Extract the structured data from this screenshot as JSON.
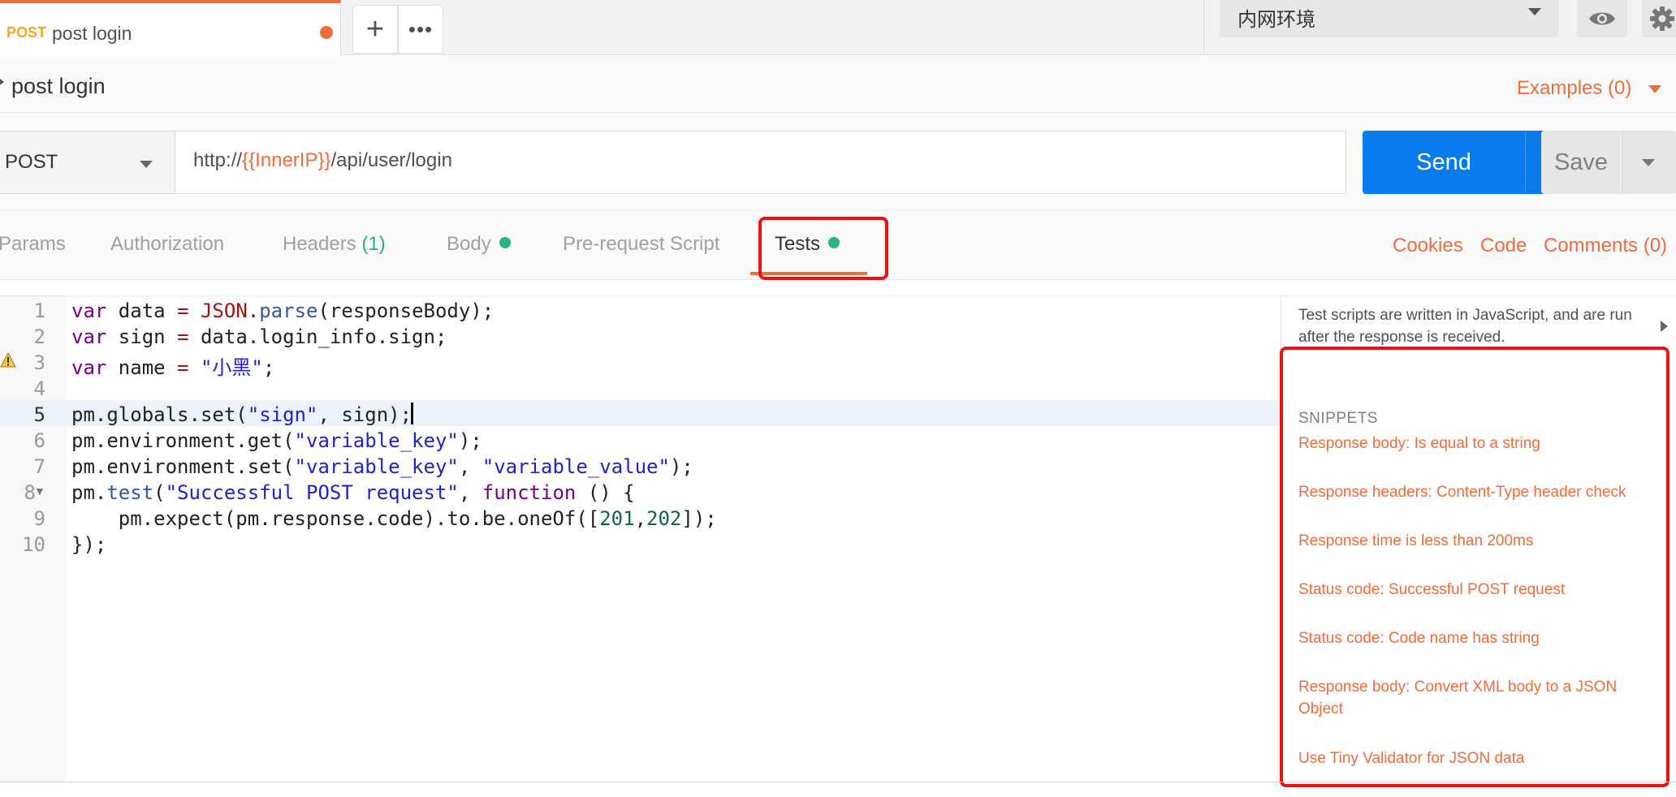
{
  "tabs": {
    "active": {
      "method": "POST",
      "name": "post login",
      "unsaved": true
    },
    "new_tab_symbol": "+",
    "more_tabs_symbol": "•••"
  },
  "environment": {
    "selected": "内网环境",
    "eye_icon": "eye-icon",
    "settings_icon": "gear-icon"
  },
  "request": {
    "title": "post login",
    "examples_label": "Examples (0)",
    "method": "POST",
    "url": {
      "prefix": "http://",
      "variable": "{{InnerIP}}",
      "suffix": "/api/user/login"
    },
    "send_label": "Send",
    "save_label": "Save"
  },
  "subtabs": {
    "params": "Params",
    "authorization": "Authorization",
    "headers": "Headers",
    "headers_count": "(1)",
    "body": "Body",
    "prerequest": "Pre-request Script",
    "tests": "Tests",
    "cookies": "Cookies",
    "code": "Code",
    "comments": "Comments (0)"
  },
  "editor": {
    "line_numbers": [
      "1",
      "2",
      "3",
      "4",
      "5",
      "6",
      "7",
      "8",
      "9",
      "10"
    ],
    "lines": [
      "var data = JSON.parse(responseBody);",
      "var sign = data.login_info.sign;",
      "var name = \"小黑\";",
      "",
      "pm.globals.set(\"sign\", sign);",
      "pm.environment.get(\"variable_key\");",
      "pm.environment.set(\"variable_key\", \"variable_value\");",
      "pm.test(\"Successful POST request\", function () {",
      "    pm.expect(pm.response.code).to.be.oneOf([201,202]);",
      "});"
    ],
    "active_line": 5,
    "warning_line": 3
  },
  "sidebar": {
    "description": "Test scripts are written in JavaScript, and are run after the response is received.",
    "snippets_title": "SNIPPETS",
    "snippets": [
      "Response body: Is equal to a string",
      "Response headers: Content-Type header check",
      "Response time is less than 200ms",
      "Status code: Successful POST request",
      "Status code: Code name has string",
      "Response body: Convert XML body to a JSON Object",
      "Use Tiny Validator for JSON data"
    ]
  },
  "colors": {
    "accent": "#f26b3a",
    "send_blue": "#097bed",
    "status_green": "#26b47f",
    "annotation_red": "#ee1111"
  }
}
